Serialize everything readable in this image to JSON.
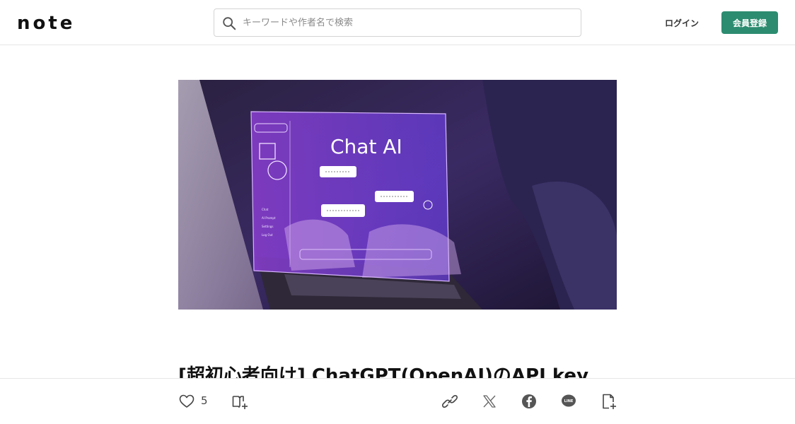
{
  "header": {
    "logo_text": "note",
    "search_placeholder": "キーワードや作者名で検索",
    "login_label": "ログイン",
    "signup_label": "会員登録",
    "signup_color": "#2c8c6f"
  },
  "hero": {
    "screen_title": "Chat AI",
    "sidebar_items": [
      "Chat",
      "AI Prompt",
      "Settings",
      "Log Out"
    ]
  },
  "article": {
    "title": "[超初心者向け] ChatGPT(OpenAI)のAPI key"
  },
  "actions": {
    "like_count": "5",
    "icons": [
      "heart-icon",
      "magazine-add-icon",
      "link-icon",
      "x-icon",
      "facebook-icon",
      "line-icon",
      "clip-icon"
    ]
  }
}
